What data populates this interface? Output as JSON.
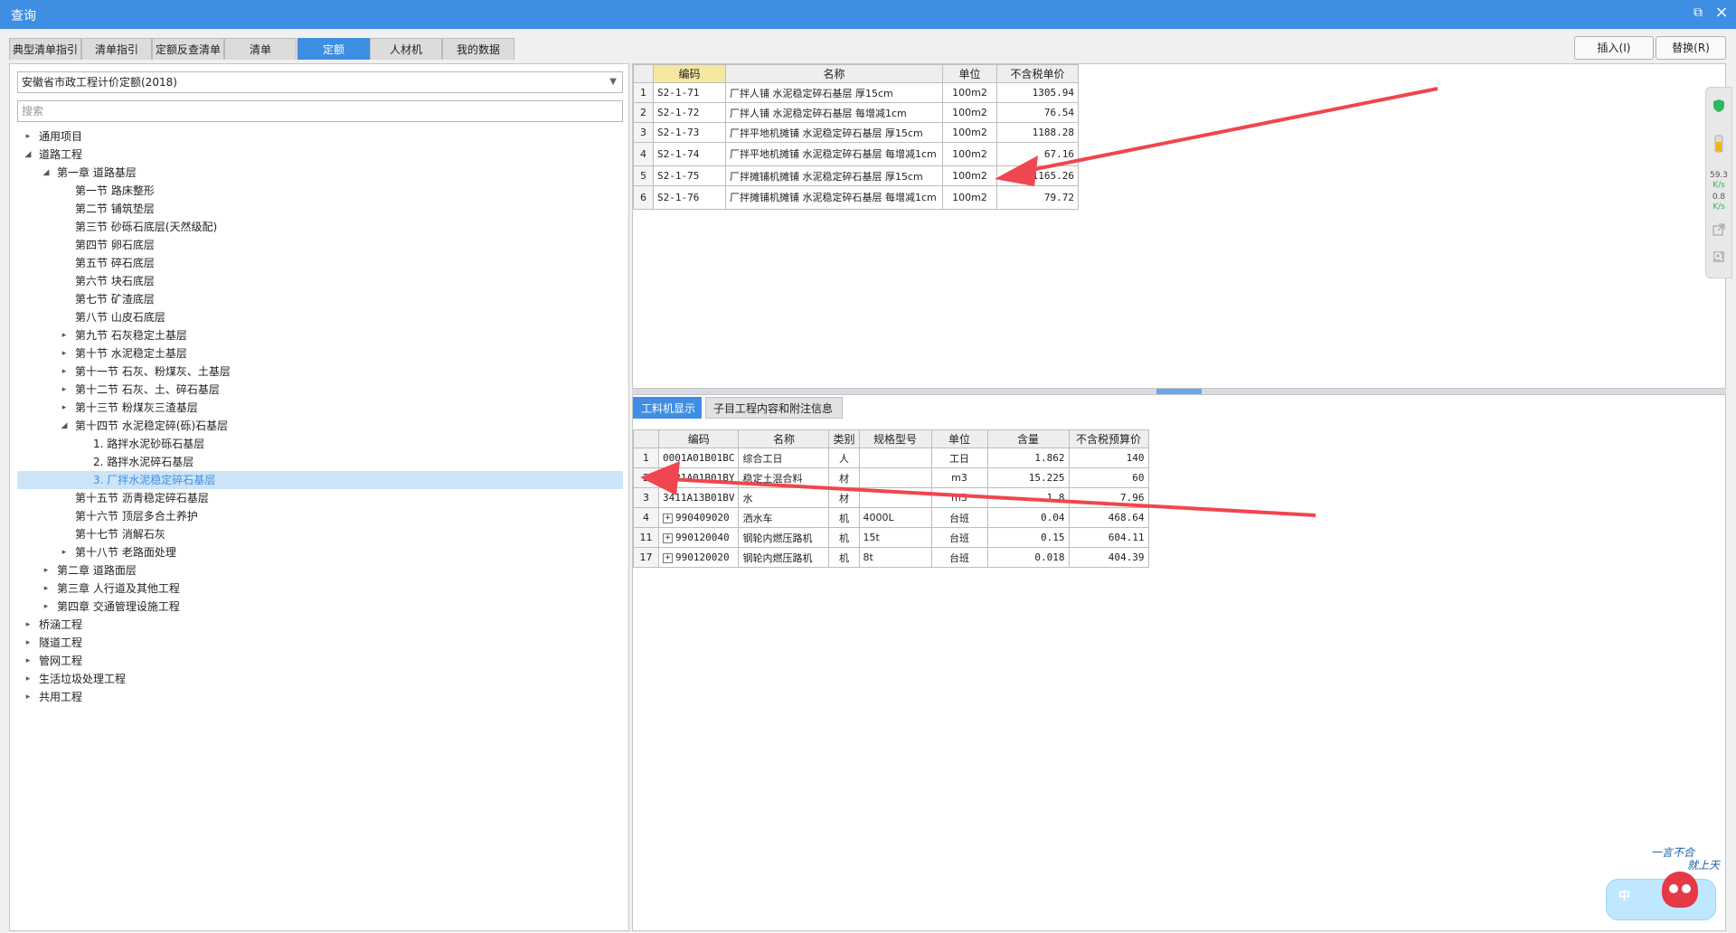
{
  "window": {
    "title": "查询",
    "restore_icon": "⧉",
    "close_icon": "×"
  },
  "tabs": [
    {
      "label": "典型清单指引"
    },
    {
      "label": "清单指引"
    },
    {
      "label": "定额反查清单"
    },
    {
      "label": "清单"
    },
    {
      "label": "定额"
    },
    {
      "label": "人材机"
    },
    {
      "label": "我的数据"
    }
  ],
  "actions": {
    "insert": "插入(I)",
    "replace": "替换(R)"
  },
  "left": {
    "combo_value": "安徽省市政工程计价定额(2018)",
    "search_placeholder": "搜索",
    "tree": [
      {
        "label": "通用项目",
        "level": 0,
        "caret": "right"
      },
      {
        "label": "道路工程",
        "level": 0,
        "caret": "down"
      },
      {
        "label": "第一章 道路基层",
        "level": 1,
        "caret": "down"
      },
      {
        "label": "第一节 路床整形",
        "level": 2,
        "caret": ""
      },
      {
        "label": "第二节 铺筑垫层",
        "level": 2,
        "caret": ""
      },
      {
        "label": "第三节 砂砾石底层(天然级配)",
        "level": 2,
        "caret": ""
      },
      {
        "label": "第四节 卵石底层",
        "level": 2,
        "caret": ""
      },
      {
        "label": "第五节 碎石底层",
        "level": 2,
        "caret": ""
      },
      {
        "label": "第六节 块石底层",
        "level": 2,
        "caret": ""
      },
      {
        "label": "第七节 矿渣底层",
        "level": 2,
        "caret": ""
      },
      {
        "label": "第八节 山皮石底层",
        "level": 2,
        "caret": ""
      },
      {
        "label": "第九节 石灰稳定土基层",
        "level": 2,
        "caret": "right"
      },
      {
        "label": "第十节 水泥稳定土基层",
        "level": 2,
        "caret": "right"
      },
      {
        "label": "第十一节 石灰、粉煤灰、土基层",
        "level": 2,
        "caret": "right"
      },
      {
        "label": "第十二节 石灰、土、碎石基层",
        "level": 2,
        "caret": "right"
      },
      {
        "label": "第十三节 粉煤灰三渣基层",
        "level": 2,
        "caret": "right"
      },
      {
        "label": "第十四节 水泥稳定碎(砾)石基层",
        "level": 2,
        "caret": "down"
      },
      {
        "label": "1. 路拌水泥砂砾石基层",
        "level": 3,
        "caret": ""
      },
      {
        "label": "2. 路拌水泥碎石基层",
        "level": 3,
        "caret": ""
      },
      {
        "label": "3. 厂拌水泥稳定碎石基层",
        "level": 3,
        "caret": "",
        "selected": true
      },
      {
        "label": "第十五节 沥青稳定碎石基层",
        "level": 2,
        "caret": ""
      },
      {
        "label": "第十六节 顶层多合土养护",
        "level": 2,
        "caret": ""
      },
      {
        "label": "第十七节 消解石灰",
        "level": 2,
        "caret": ""
      },
      {
        "label": "第十八节 老路面处理",
        "level": 2,
        "caret": "right"
      },
      {
        "label": "第二章 道路面层",
        "level": 1,
        "caret": "right"
      },
      {
        "label": "第三章 人行道及其他工程",
        "level": 1,
        "caret": "right"
      },
      {
        "label": "第四章 交通管理设施工程",
        "level": 1,
        "caret": "right"
      },
      {
        "label": "桥涵工程",
        "level": 0,
        "caret": "right"
      },
      {
        "label": "隧道工程",
        "level": 0,
        "caret": "right"
      },
      {
        "label": "管网工程",
        "level": 0,
        "caret": "right"
      },
      {
        "label": "生活垃圾处理工程",
        "level": 0,
        "caret": "right"
      },
      {
        "label": "共用工程",
        "level": 0,
        "caret": "right"
      }
    ]
  },
  "quota_table": {
    "headers": [
      "编码",
      "名称",
      "单位",
      "不含税单价"
    ],
    "rows": [
      {
        "n": "1",
        "code": "S2-1-71",
        "name": "厂拌人铺 水泥稳定碎石基层 厚15cm",
        "unit": "100m2",
        "price": "1305.94"
      },
      {
        "n": "2",
        "code": "S2-1-72",
        "name": "厂拌人铺 水泥稳定碎石基层 每增减1cm",
        "unit": "100m2",
        "price": "76.54"
      },
      {
        "n": "3",
        "code": "S2-1-73",
        "name": "厂拌平地机摊铺 水泥稳定碎石基层 厚15cm",
        "unit": "100m2",
        "price": "1188.28"
      },
      {
        "n": "4",
        "code": "S2-1-74",
        "name": "厂拌平地机摊铺 水泥稳定碎石基层 每增减1cm",
        "unit": "100m2",
        "price": "67.16"
      },
      {
        "n": "5",
        "code": "S2-1-75",
        "name": "厂拌摊铺机摊铺 水泥稳定碎石基层 厚15cm",
        "unit": "100m2",
        "price": "1165.26"
      },
      {
        "n": "6",
        "code": "S2-1-76",
        "name": "厂拌摊铺机摊铺 水泥稳定碎石基层 每增减1cm",
        "unit": "100m2",
        "price": "79.72"
      }
    ]
  },
  "subtabs": [
    "工料机显示",
    "子目工程内容和附注信息"
  ],
  "material_table": {
    "headers": [
      "编码",
      "名称",
      "类别",
      "规格型号",
      "单位",
      "含量",
      "不含税预算价"
    ],
    "rows": [
      {
        "n": "1",
        "exp": false,
        "code": "0001A01B01BC",
        "name": "综合工日",
        "cat": "人",
        "spec": "",
        "unit": "工日",
        "qty": "1.862",
        "price": "140"
      },
      {
        "n": "2",
        "exp": false,
        "code": "8021A01B01BY",
        "name": "稳定土混合料",
        "cat": "材",
        "spec": "",
        "unit": "m3",
        "qty": "15.225",
        "price": "60"
      },
      {
        "n": "3",
        "exp": false,
        "code": "3411A13B01BV",
        "name": "水",
        "cat": "材",
        "spec": "",
        "unit": "m3",
        "qty": "1.8",
        "price": "7.96"
      },
      {
        "n": "4",
        "exp": true,
        "code": "990409020",
        "name": "洒水车",
        "cat": "机",
        "spec": "4000L",
        "unit": "台班",
        "qty": "0.04",
        "price": "468.64"
      },
      {
        "n": "11",
        "exp": true,
        "code": "990120040",
        "name": "钢轮内燃压路机",
        "cat": "机",
        "spec": "15t",
        "unit": "台班",
        "qty": "0.15",
        "price": "604.11"
      },
      {
        "n": "17",
        "exp": true,
        "code": "990120020",
        "name": "钢轮内燃压路机",
        "cat": "机",
        "spec": "8t",
        "unit": "台班",
        "qty": "0.018",
        "price": "404.39"
      }
    ]
  },
  "sidewidget": {
    "speed_up": "59.3",
    "speed_down": "0.8",
    "unit": "K/s"
  },
  "mascot": {
    "slogan_line1": "一言不合",
    "slogan_line2": "就上天",
    "ime_label": "中"
  },
  "colors": {
    "accent": "#3e8ee3",
    "arrow": "#f0464f",
    "selected_row": "#cce4f7"
  }
}
